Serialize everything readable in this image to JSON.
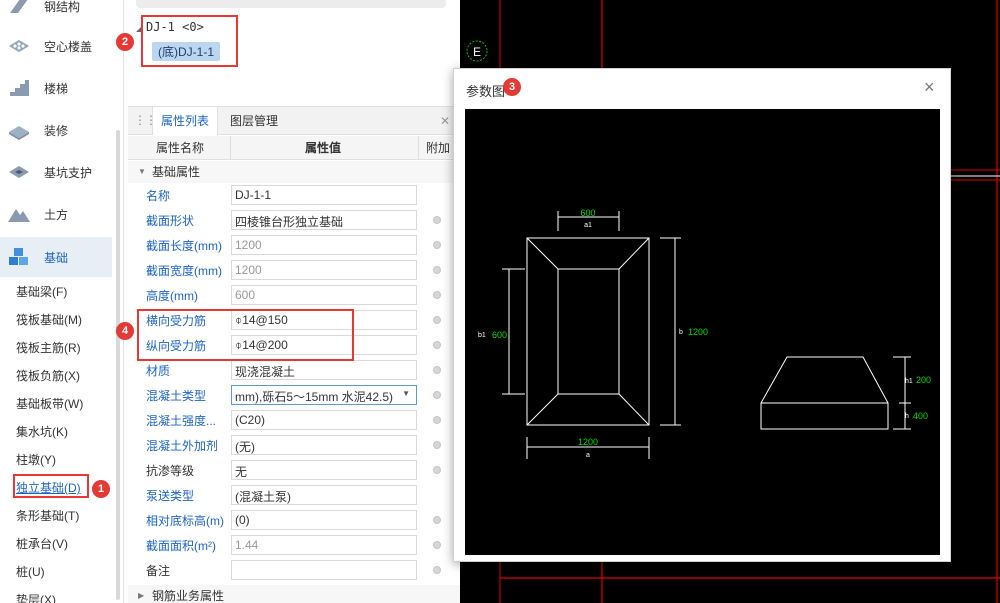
{
  "nav": {
    "categories": [
      {
        "label": "钢结构",
        "icon": "steel-structure-icon"
      },
      {
        "label": "空心楼盖",
        "icon": "hollow-floor-icon"
      },
      {
        "label": "楼梯",
        "icon": "stairs-icon"
      },
      {
        "label": "装修",
        "icon": "decoration-icon"
      },
      {
        "label": "基坑支护",
        "icon": "pit-support-icon"
      },
      {
        "label": "土方",
        "icon": "earthwork-icon"
      },
      {
        "label": "基础",
        "icon": "foundation-icon"
      }
    ],
    "subitems": [
      "基础梁(F)",
      "筏板基础(M)",
      "筏板主筋(R)",
      "筏板负筋(X)",
      "基础板带(W)",
      "集水坑(K)",
      "柱墩(Y)",
      "独立基础(D)",
      "条形基础(T)",
      "桩承台(V)",
      "桩(U)",
      "垫层(X)"
    ]
  },
  "tree": {
    "root": "DJ-1 <0>",
    "item": "(底)DJ-1-1"
  },
  "badges": [
    "1",
    "2",
    "3",
    "4"
  ],
  "props": {
    "tabs": [
      "属性列表",
      "图层管理"
    ],
    "columns": [
      "属性名称",
      "属性值",
      "附加"
    ],
    "group1": "基础属性",
    "rows": [
      {
        "name": "名称",
        "value": "DJ-1-1"
      },
      {
        "name": "截面形状",
        "value": "四棱锥台形独立基础"
      },
      {
        "name": "截面长度(mm)",
        "value": "1200"
      },
      {
        "name": "截面宽度(mm)",
        "value": "1200"
      },
      {
        "name": "高度(mm)",
        "value": "600"
      },
      {
        "name": "横向受力筋",
        "value": "⌽14@150"
      },
      {
        "name": "纵向受力筋",
        "value": "⌽14@200"
      },
      {
        "name": "材质",
        "value": "现浇混凝土"
      },
      {
        "name": "混凝土类型",
        "value": "mm),砾石5～15mm 水泥42.5)"
      },
      {
        "name": "混凝土强度...",
        "value": "(C20)"
      },
      {
        "name": "混凝土外加剂",
        "value": "(无)"
      },
      {
        "name": "抗渗等级",
        "value": "无"
      },
      {
        "name": "泵送类型",
        "value": "(混凝土泵)"
      },
      {
        "name": "相对底标高(m)",
        "value": "(0)"
      },
      {
        "name": "截面面积(m²)",
        "value": "1.44"
      },
      {
        "name": "备注",
        "value": ""
      }
    ],
    "group2": "钢筋业务属性"
  },
  "dialog": {
    "title": "参数图",
    "close": "×"
  },
  "cad": {
    "axis_label": "E",
    "dims": {
      "a1_value": "600",
      "a1_label": "a1",
      "b1_label": "b1",
      "b1_value": "600",
      "b_label": "b",
      "b_value": "1200",
      "a_value": "1200",
      "a_label": "a",
      "h1_label": "h1",
      "h1_value": "200",
      "h_label": "h",
      "h_value": "400"
    }
  },
  "colors": {
    "accent": "#1c64c6",
    "highlight": "#e53935",
    "cad_bg": "#000000",
    "cad_grid": "#e00000",
    "dim_text": "#00e000"
  }
}
